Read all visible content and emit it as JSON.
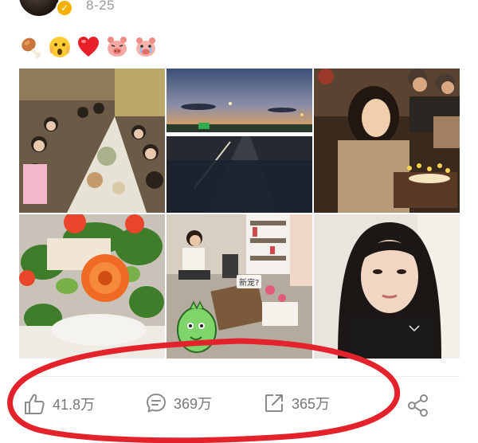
{
  "post": {
    "time": "8-25",
    "verified_icon": "verified-v-icon"
  },
  "emojis": [
    "drumstick",
    "shocked-face",
    "red-heart",
    "pig-face",
    "pig-face-crying"
  ],
  "photos": [
    {
      "scene": "group-dinner"
    },
    {
      "scene": "sunset-road"
    },
    {
      "scene": "birthday-cake"
    },
    {
      "scene": "flower-bouquet"
    },
    {
      "scene": "gifts-unboxing",
      "label": "新宠?"
    },
    {
      "scene": "selfie"
    }
  ],
  "actions": {
    "like_count": "41.8万",
    "comment_count": "369万",
    "repost_count": "365万"
  },
  "colors": {
    "annotation_red": "#e4222b",
    "action_gray": "#777777",
    "badge_gold": "#f5b100"
  }
}
